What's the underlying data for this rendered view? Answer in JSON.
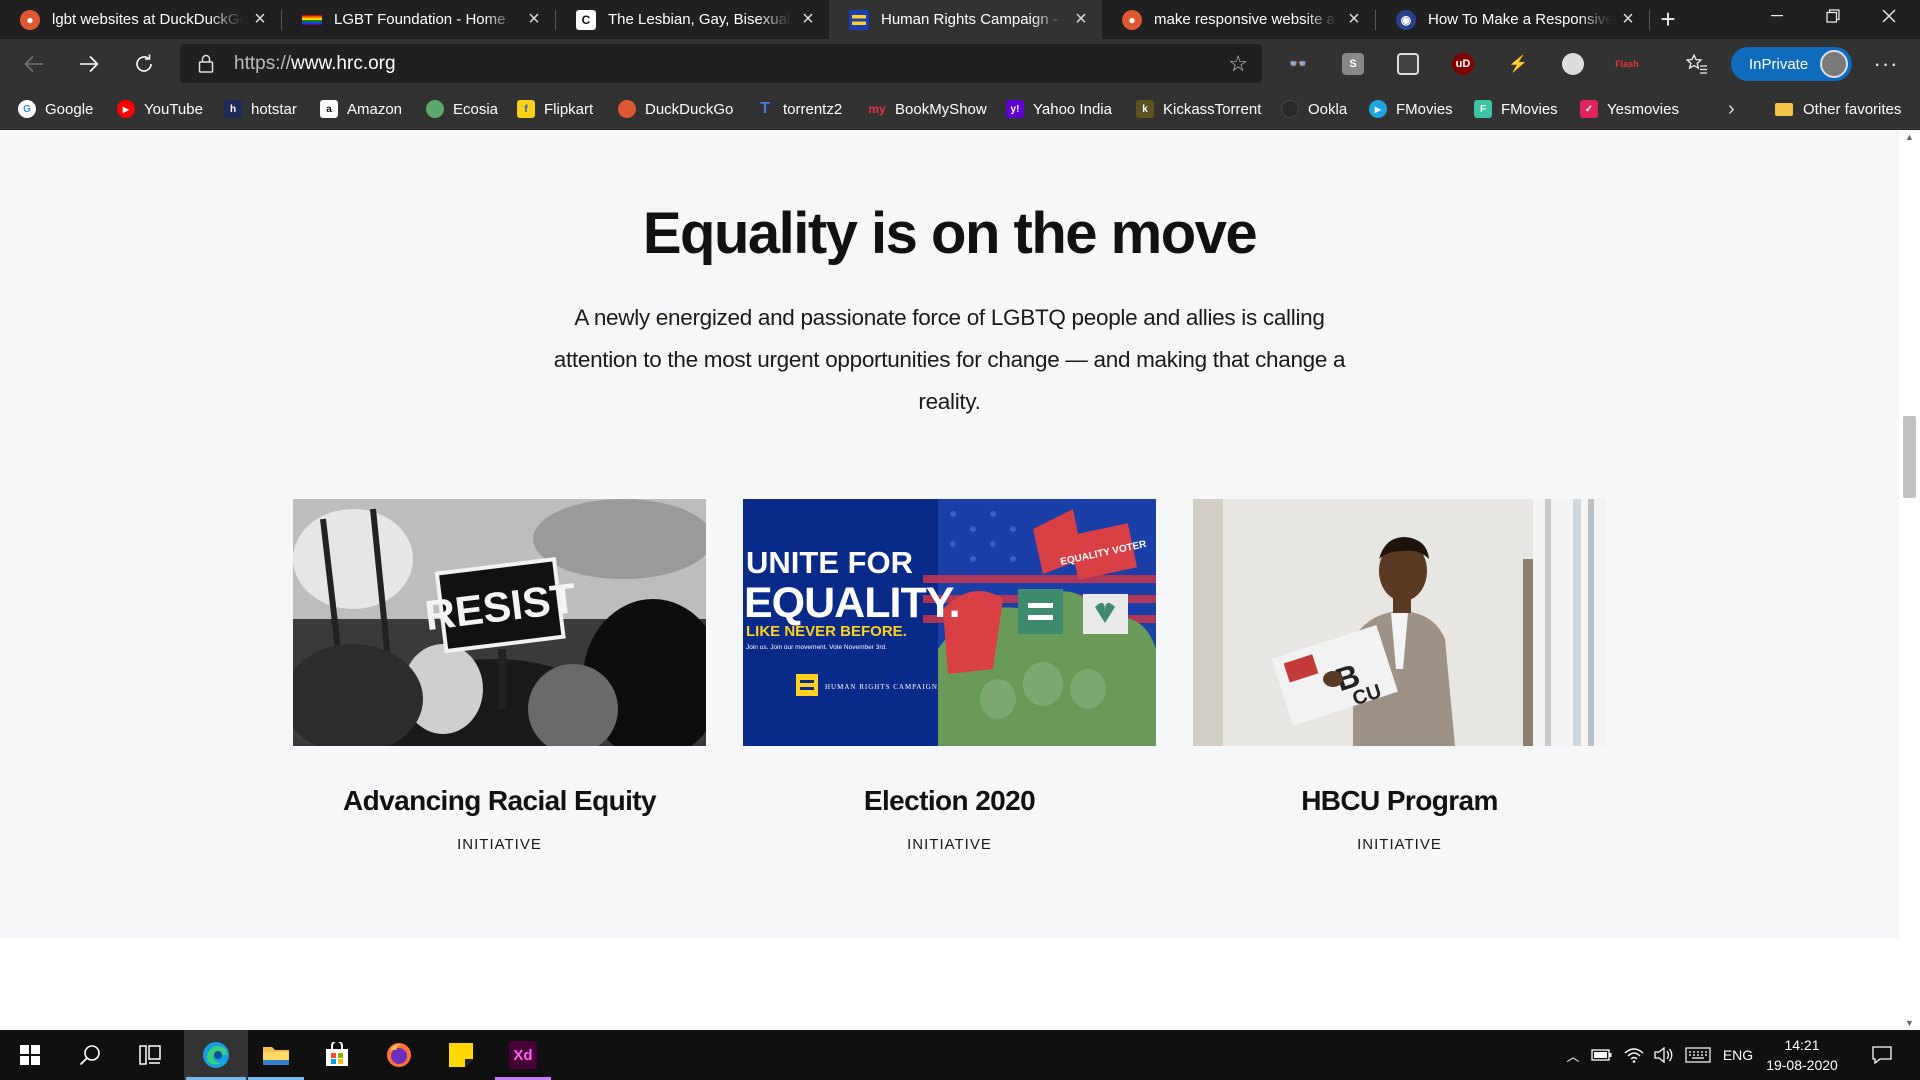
{
  "browser": {
    "tabs": [
      {
        "title": "lgbt websites at DuckDuckGo",
        "icon": "duckduckgo-icon",
        "active": false
      },
      {
        "title": "LGBT Foundation - Home",
        "icon": "lgbt-foundation-icon",
        "active": false
      },
      {
        "title": "The Lesbian, Gay, Bisexual & Transgender",
        "icon": "c-site-icon",
        "active": false
      },
      {
        "title": "Human Rights Campaign - Home",
        "icon": "hrc-icon",
        "active": true
      },
      {
        "title": "make responsive website at DuckDuckGo",
        "icon": "duckduckgo-icon",
        "active": false
      },
      {
        "title": "How To Make a Responsive Website",
        "icon": "owl-icon",
        "active": false
      }
    ],
    "url_scheme": "https://",
    "url_host": "www.hrc.org",
    "inprivate_label": "InPrivate",
    "extensions": [
      "ext-reader-icon",
      "ext-s-icon",
      "ext-link-icon",
      "ublock-icon",
      "ext-bolt-icon",
      "ext-circle-icon",
      "flash-icon"
    ],
    "favorites": [
      {
        "label": "Google",
        "icon": "google-icon"
      },
      {
        "label": "YouTube",
        "icon": "youtube-icon"
      },
      {
        "label": "hotstar",
        "icon": "hotstar-icon"
      },
      {
        "label": "Amazon",
        "icon": "amazon-icon"
      },
      {
        "label": "Ecosia",
        "icon": "ecosia-icon"
      },
      {
        "label": "Flipkart",
        "icon": "flipkart-icon"
      },
      {
        "label": "DuckDuckGo",
        "icon": "duckduckgo-icon"
      },
      {
        "label": "torrentz2",
        "icon": "torrentz-icon"
      },
      {
        "label": "BookMyShow",
        "icon": "bookmyshow-icon"
      },
      {
        "label": "Yahoo India",
        "icon": "yahoo-icon"
      },
      {
        "label": "KickassTorrent",
        "icon": "kickass-icon"
      },
      {
        "label": "Ookla",
        "icon": "ookla-icon"
      },
      {
        "label": "FMovies",
        "icon": "fmovies-play-icon"
      },
      {
        "label": "FMovies",
        "icon": "fmovies-f-icon"
      },
      {
        "label": "Yesmovies",
        "icon": "yesmovies-icon"
      }
    ],
    "other_favorites": "Other favorites"
  },
  "page": {
    "heading": "Equality is on the move",
    "lede": "A newly energized and passionate force of LGBTQ people and allies is calling attention to the most urgent opportunities for change — and making that change a reality.",
    "cards": [
      {
        "title": "Advancing Racial Equity",
        "kicker": "INITIATIVE",
        "image_sign": "RESIST"
      },
      {
        "title": "Election 2020",
        "kicker": "INITIATIVE",
        "image_line1": "UNITE FOR",
        "image_line2": "EQUALITY.",
        "image_line3": "LIKE NEVER BEFORE.",
        "image_line4": "Join us. Join our movement. Vote November 3rd.",
        "image_logo": "HUMAN RIGHTS CAMPAIGN",
        "image_sign": "EQUALITY VOTER"
      },
      {
        "title": "HBCU Program",
        "kicker": "INITIATIVE"
      }
    ]
  },
  "taskbar": {
    "apps": [
      "windows-start-icon",
      "search-icon",
      "task-view-icon",
      "edge-icon",
      "file-explorer-icon",
      "store-icon",
      "firefox-icon",
      "sticky-notes-icon",
      "adobe-xd-icon"
    ],
    "xd_label": "Xd",
    "language": "ENG",
    "time": "14:21",
    "date": "19-08-2020"
  },
  "colors": {
    "hrc_blue": "#0a2a8a",
    "hrc_yellow": "#ffd21f",
    "edge_accent": "#0f6cbd"
  }
}
